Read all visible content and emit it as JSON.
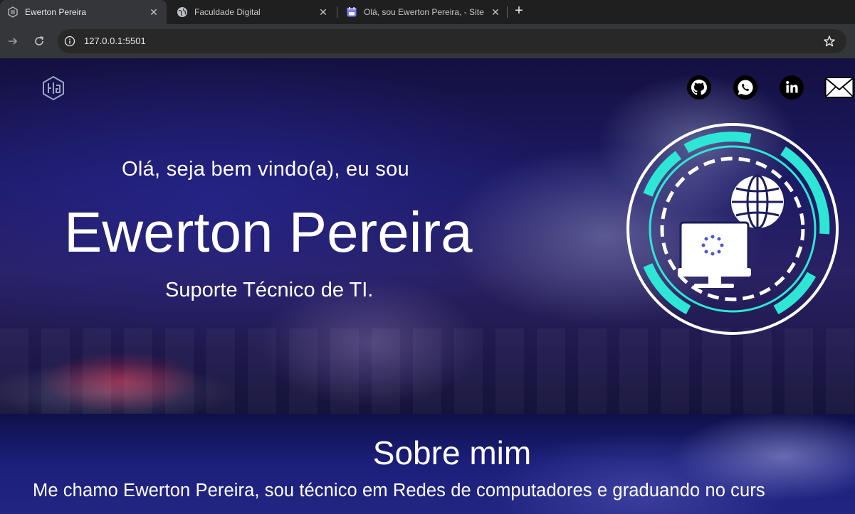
{
  "browser": {
    "tabs": [
      {
        "title": "Ewerton Pereira",
        "icon": "site-logo-icon",
        "active": true
      },
      {
        "title": "Faculdade Digital",
        "icon": "globe-icon",
        "active": false
      },
      {
        "title": "Olá, sou Ewerton Pereira, - Site",
        "icon": "calendar-app-icon",
        "active": false
      }
    ],
    "address": "127.0.0.1:5501"
  },
  "hero": {
    "greeting": "Olá, seja bem vindo(a), eu sou",
    "name": "Ewerton Pereira",
    "role": "Suporte Técnico de TI.",
    "social": [
      "github-icon",
      "whatsapp-icon",
      "linkedin-icon",
      "mail-icon"
    ]
  },
  "about": {
    "title": "Sobre mim",
    "text": "Me chamo Ewerton Pereira, sou técnico em Redes de computadores e graduando no curs"
  },
  "colors": {
    "accent": "#2ee6d6",
    "hero_bg": "#1d1a66",
    "about_bg": "#1b1f7a"
  }
}
